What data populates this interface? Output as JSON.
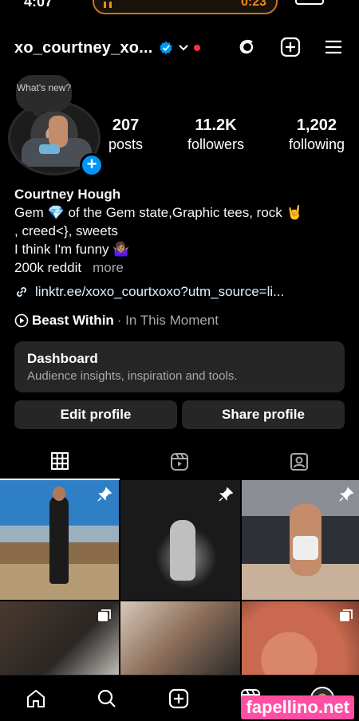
{
  "status": {
    "time": "4:07",
    "timer": "0:23"
  },
  "header": {
    "username": "xo_courtney_xo..."
  },
  "note": {
    "text": "What's new?"
  },
  "stats": [
    {
      "num": "207",
      "label": "posts"
    },
    {
      "num": "11.2K",
      "label": "followers"
    },
    {
      "num": "1,202",
      "label": "following"
    }
  ],
  "bio": {
    "name": "Courtney Hough",
    "line1": "Gem 💎 of the Gem state,Graphic tees, rock 🤘",
    "line2": ", creed<}, sweets",
    "line3": "I think I'm funny 🤷🏽‍♀️",
    "line4": "200k reddit",
    "more": "more",
    "link": "linktr.ee/xoxo_courtxoxo?utm_source=li..."
  },
  "music": {
    "title": "Beast Within",
    "artist": "· In This Moment"
  },
  "dashboard": {
    "title": "Dashboard",
    "subtitle": "Audience insights, inspiration and tools."
  },
  "actions": {
    "edit": "Edit profile",
    "share": "Share profile"
  },
  "colors": {
    "accent": "#0095f6",
    "card": "#262626",
    "muted": "#a8a8a8",
    "badge_red": "#ff3040"
  },
  "icons": {
    "tabs": [
      "grid-icon",
      "reels-icon",
      "tagged-icon"
    ],
    "nav": [
      "home-icon",
      "search-icon",
      "create-icon",
      "reels-icon",
      "profile-avatar"
    ]
  },
  "watermark": "fapellino.net"
}
